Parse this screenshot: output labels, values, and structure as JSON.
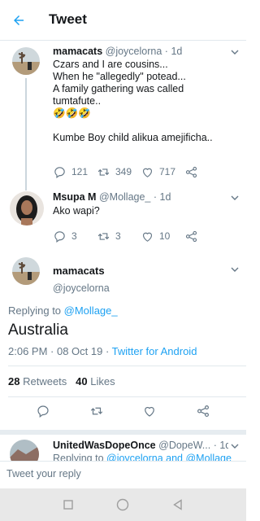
{
  "header": {
    "title": "Tweet",
    "back_icon": "arrow-left-icon"
  },
  "colors": {
    "accent": "#1da1f2",
    "secondary_text": "#657786",
    "border": "#e1e8ed",
    "thread_line": "#ccd6dd"
  },
  "thread": [
    {
      "name": "mamacats",
      "handle": "@joycelorna",
      "time": "1d",
      "text": "Czars and I are cousins...\n When he \"allegedly\" potead...\n A family gathering was called\ntumtafute..\n🤣🤣🤣\n\nKumbe Boy child alikua amejificha..",
      "replies": "121",
      "retweets": "349",
      "likes": "717"
    },
    {
      "name": "Msupa M",
      "handle": "@Mollage_",
      "time": "1d",
      "text": "Ako wapi?",
      "replies": "3",
      "retweets": "3",
      "likes": "10"
    }
  ],
  "main_tweet": {
    "name": "mamacats",
    "handle": "@joycelorna",
    "replying_prefix": "Replying to ",
    "replying_to": "@Mollage_",
    "text": "Australia",
    "timestamp": "2:06 PM · 08 Oct 19 · ",
    "source": "Twitter for Android",
    "retweets_count": "28",
    "retweets_label": "Retweets",
    "likes_count": "40",
    "likes_label": "Likes"
  },
  "next_tweet": {
    "name": "UnitedWasDopeOnce",
    "handle": "@DopeW...",
    "time": "1d",
    "sub_prefix": "Replying to ",
    "sub_links": "@joycelorna and @Mollage_"
  },
  "compose": {
    "placeholder": "Tweet your reply"
  },
  "nav": {
    "square": "recent-apps-icon",
    "circle": "home-icon",
    "triangle": "back-icon"
  }
}
